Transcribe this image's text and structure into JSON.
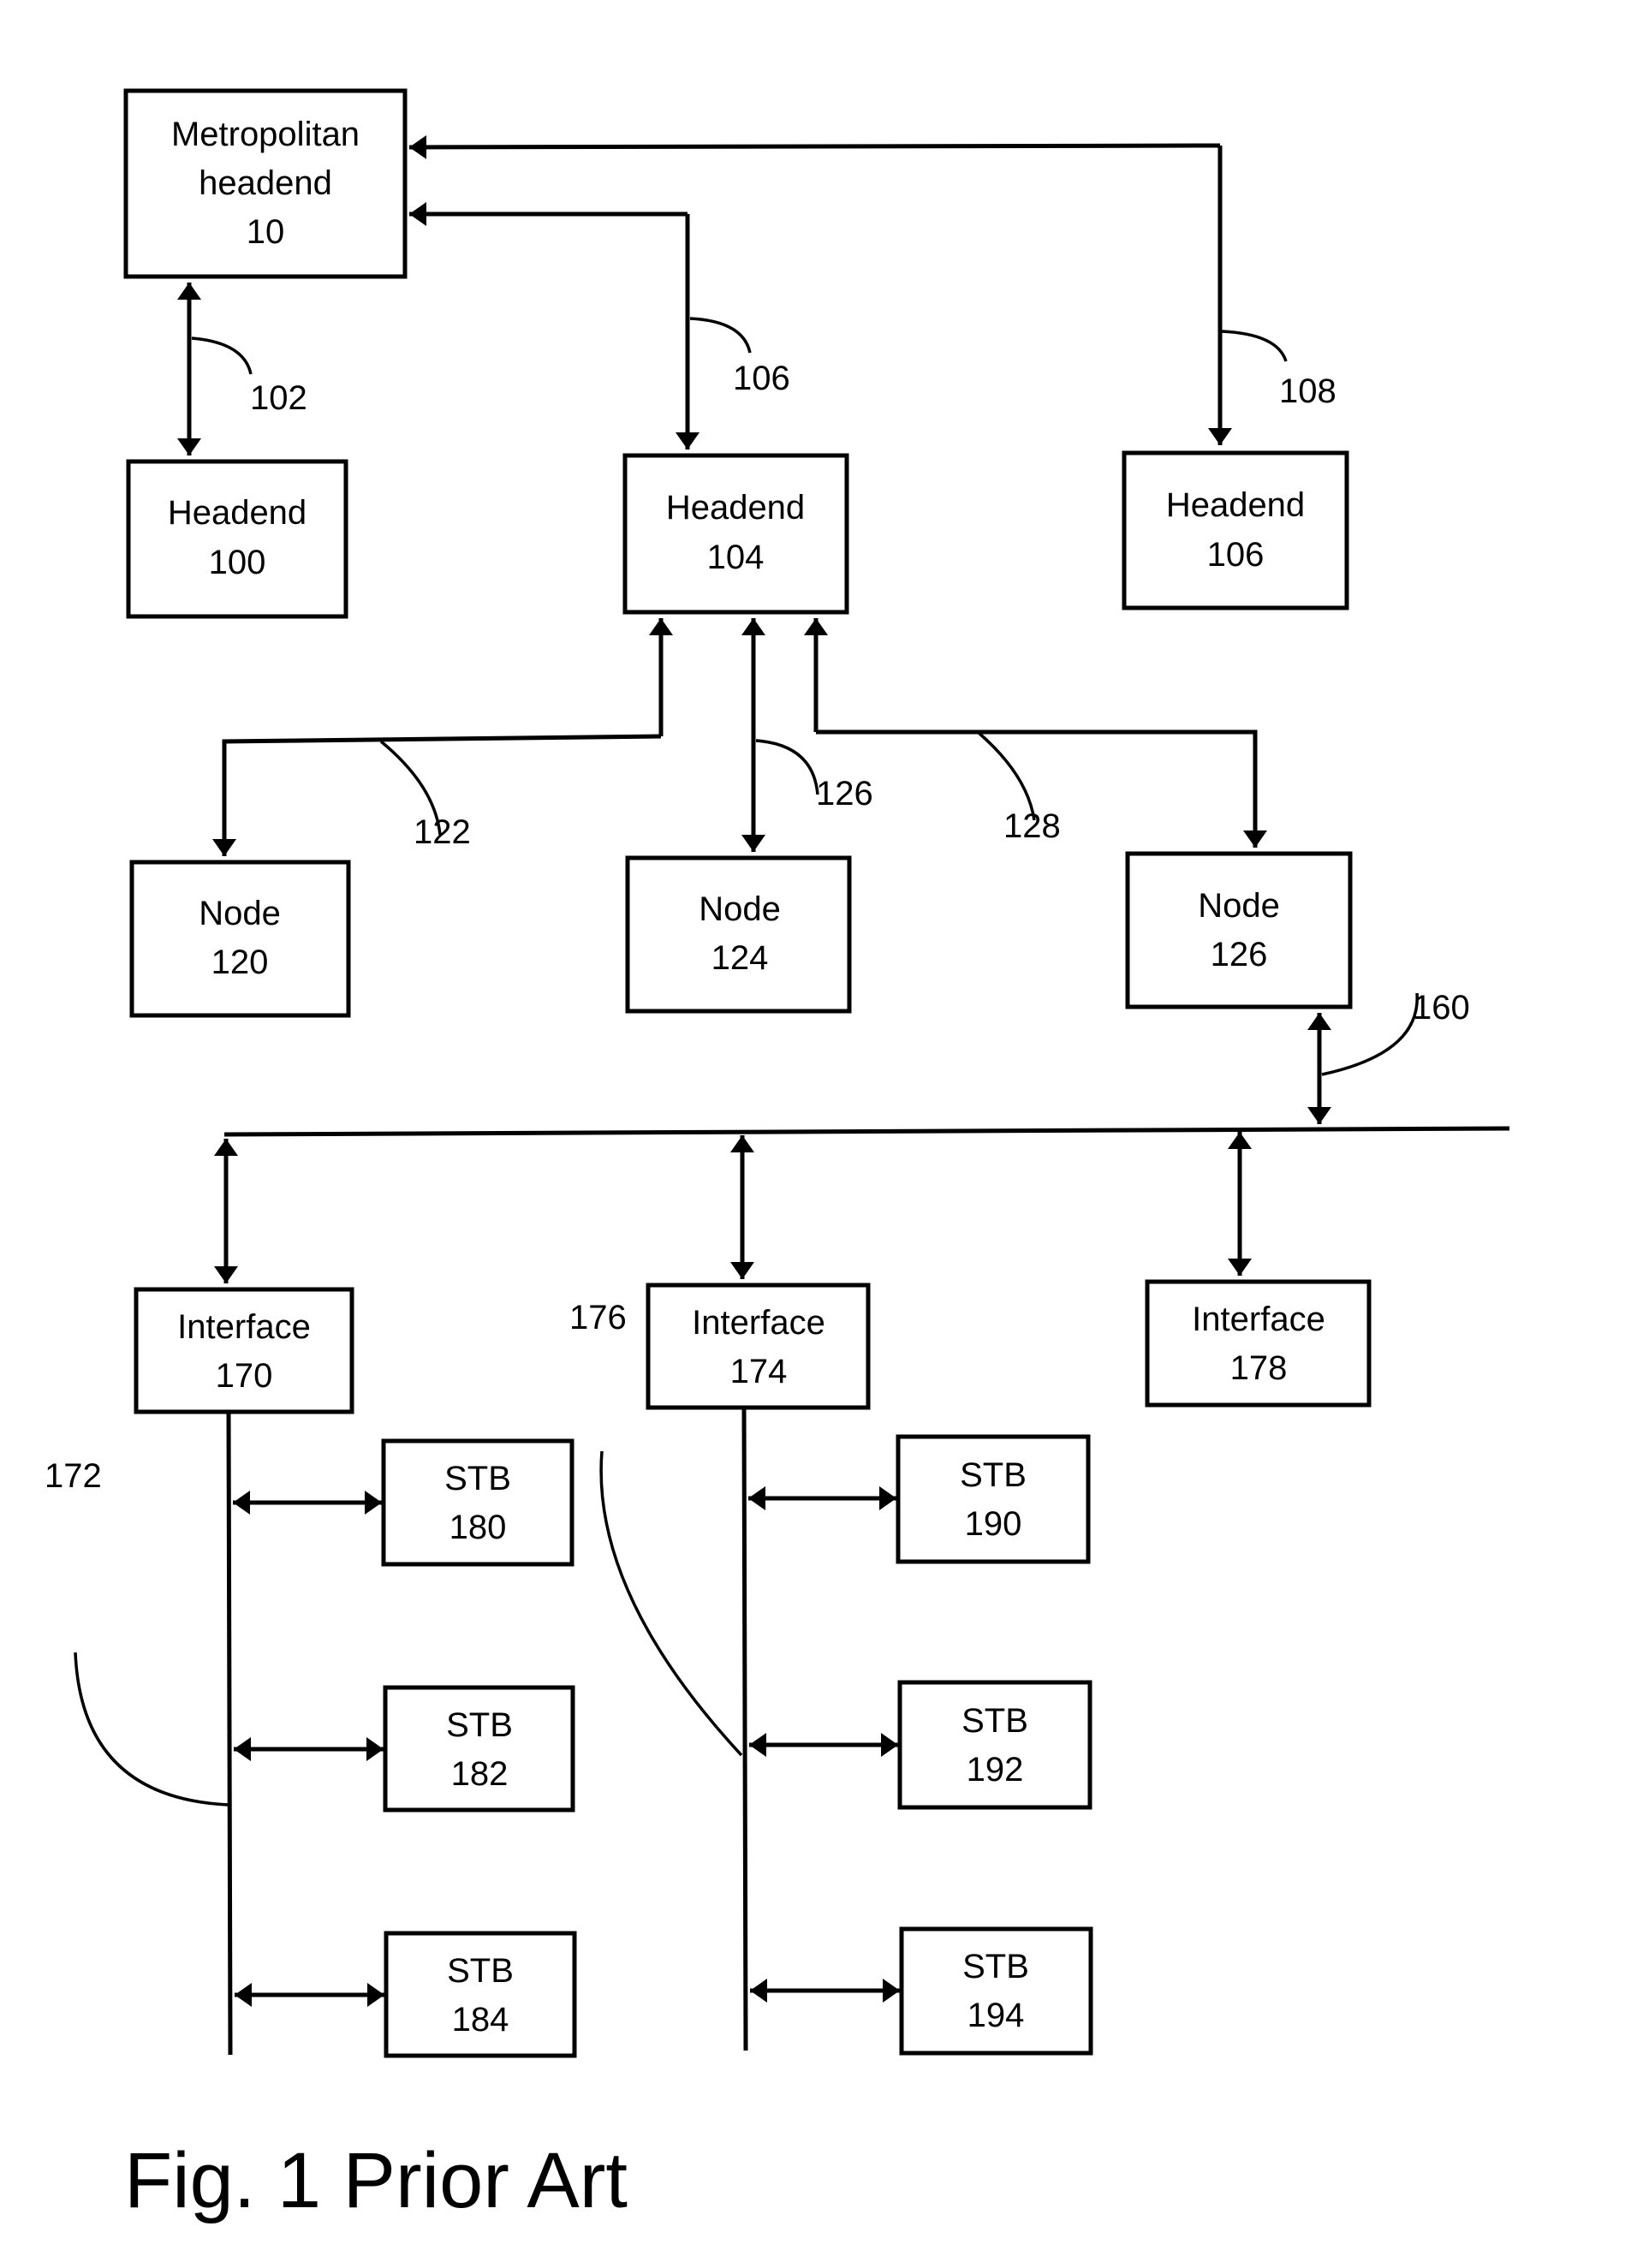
{
  "figure": {
    "caption": "Fig. 1 Prior Art"
  },
  "nodes": {
    "metro": {
      "line1": "Metropolitan",
      "line2": "headend",
      "line3": "10"
    },
    "headend100": {
      "line1": "Headend",
      "line2": "100"
    },
    "headend104": {
      "line1": "Headend",
      "line2": "104"
    },
    "headend106": {
      "line1": "Headend",
      "line2": "106"
    },
    "node120": {
      "line1": "Node",
      "line2": "120"
    },
    "node124": {
      "line1": "Node",
      "line2": "124"
    },
    "node126": {
      "line1": "Node",
      "line2": "126"
    },
    "interface170": {
      "line1": "Interface",
      "line2": "170"
    },
    "interface174": {
      "line1": "Interface",
      "line2": "174"
    },
    "interface178": {
      "line1": "Interface",
      "line2": "178"
    },
    "stb180": {
      "line1": "STB",
      "line2": "180"
    },
    "stb182": {
      "line1": "STB",
      "line2": "182"
    },
    "stb184": {
      "line1": "STB",
      "line2": "184"
    },
    "stb190": {
      "line1": "STB",
      "line2": "190"
    },
    "stb192": {
      "line1": "STB",
      "line2": "192"
    },
    "stb194": {
      "line1": "STB",
      "line2": "194"
    }
  },
  "links": {
    "l102": "102",
    "l106": "106",
    "l108": "108",
    "l122": "122",
    "l126": "126",
    "l128": "128",
    "l160": "160",
    "l172": "172",
    "l176": "176"
  }
}
